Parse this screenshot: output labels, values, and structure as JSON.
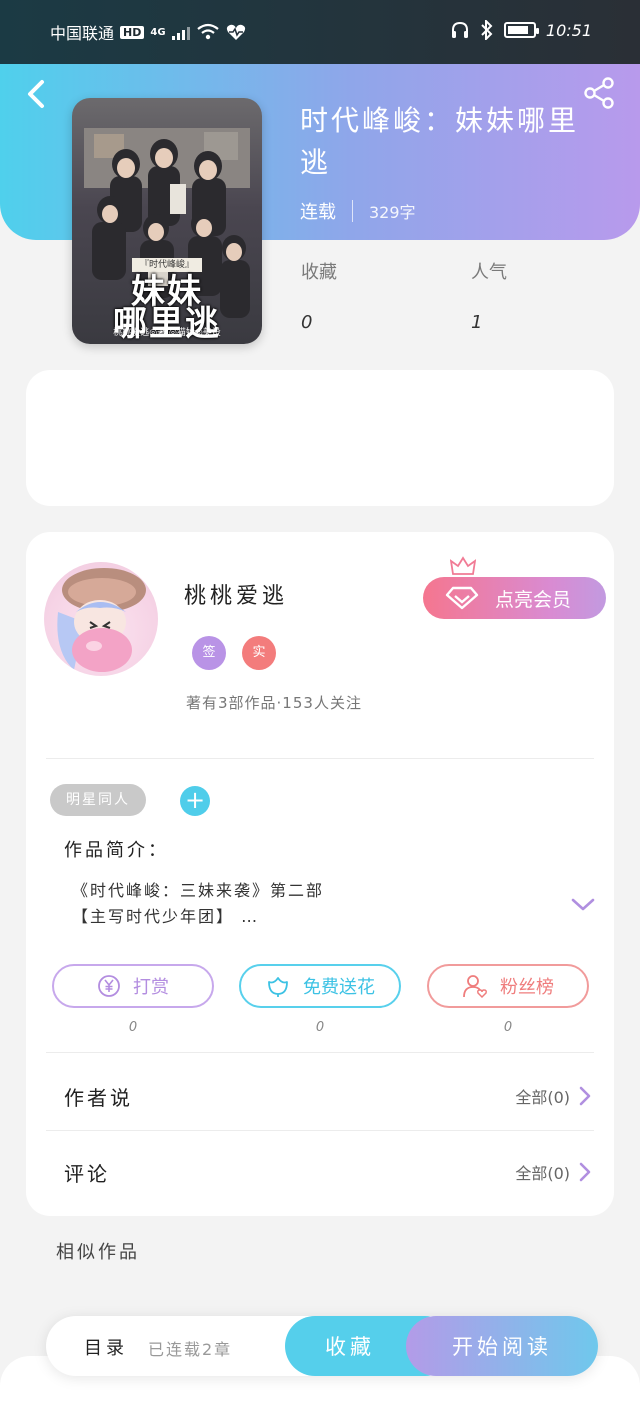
{
  "status_bar": {
    "carrier": "中国联通",
    "hd": "HD",
    "network": "4G",
    "time": "10:51",
    "battery_level": 0.85
  },
  "header": {
    "title": "时代峰峻：妹妹哪里逃",
    "status": "连载",
    "word_count": "329字"
  },
  "cover": {
    "banner": "『时代峰峻』",
    "title_line1": "妹妹",
    "title_line2": "哪里逃",
    "authors": "桃桃爱逃◎著 ◎猫妙◎美设"
  },
  "stats": {
    "favorites_label": "收藏",
    "favorites_value": "0",
    "popularity_label": "人气",
    "popularity_value": "1"
  },
  "author": {
    "name": "桃桃爱逃",
    "badge_sign": "签",
    "badge_real": "实",
    "summary": "著有3部作品·153人关注",
    "vip_label": "点亮会员"
  },
  "tags": {
    "tag1": "明星同人",
    "add": "+"
  },
  "intro": {
    "label": "作品简介：",
    "line1": "《时代峰峻：三妹来袭》第二部",
    "line2": "【主写时代少年团】 …"
  },
  "actions": [
    {
      "label": "打赏",
      "count": "0",
      "icon": "yen-coin-icon"
    },
    {
      "label": "免费送花",
      "count": "0",
      "icon": "flower-icon"
    },
    {
      "label": "粉丝榜",
      "count": "0",
      "icon": "fans-user-icon"
    }
  ],
  "rows": {
    "author_says_label": "作者说",
    "author_says_value": "全部(0)",
    "comments_label": "评论",
    "comments_value": "全部(0)"
  },
  "similar_label": "相似作品",
  "bottom": {
    "toc": "目录",
    "toc_sub": "已连载2章",
    "favorite": "收藏",
    "start_reading": "开始阅读"
  },
  "colors": {
    "accent_cyan": "#4fd0ec",
    "accent_purple": "#b89aec",
    "vip_pink": "#f5768f"
  }
}
